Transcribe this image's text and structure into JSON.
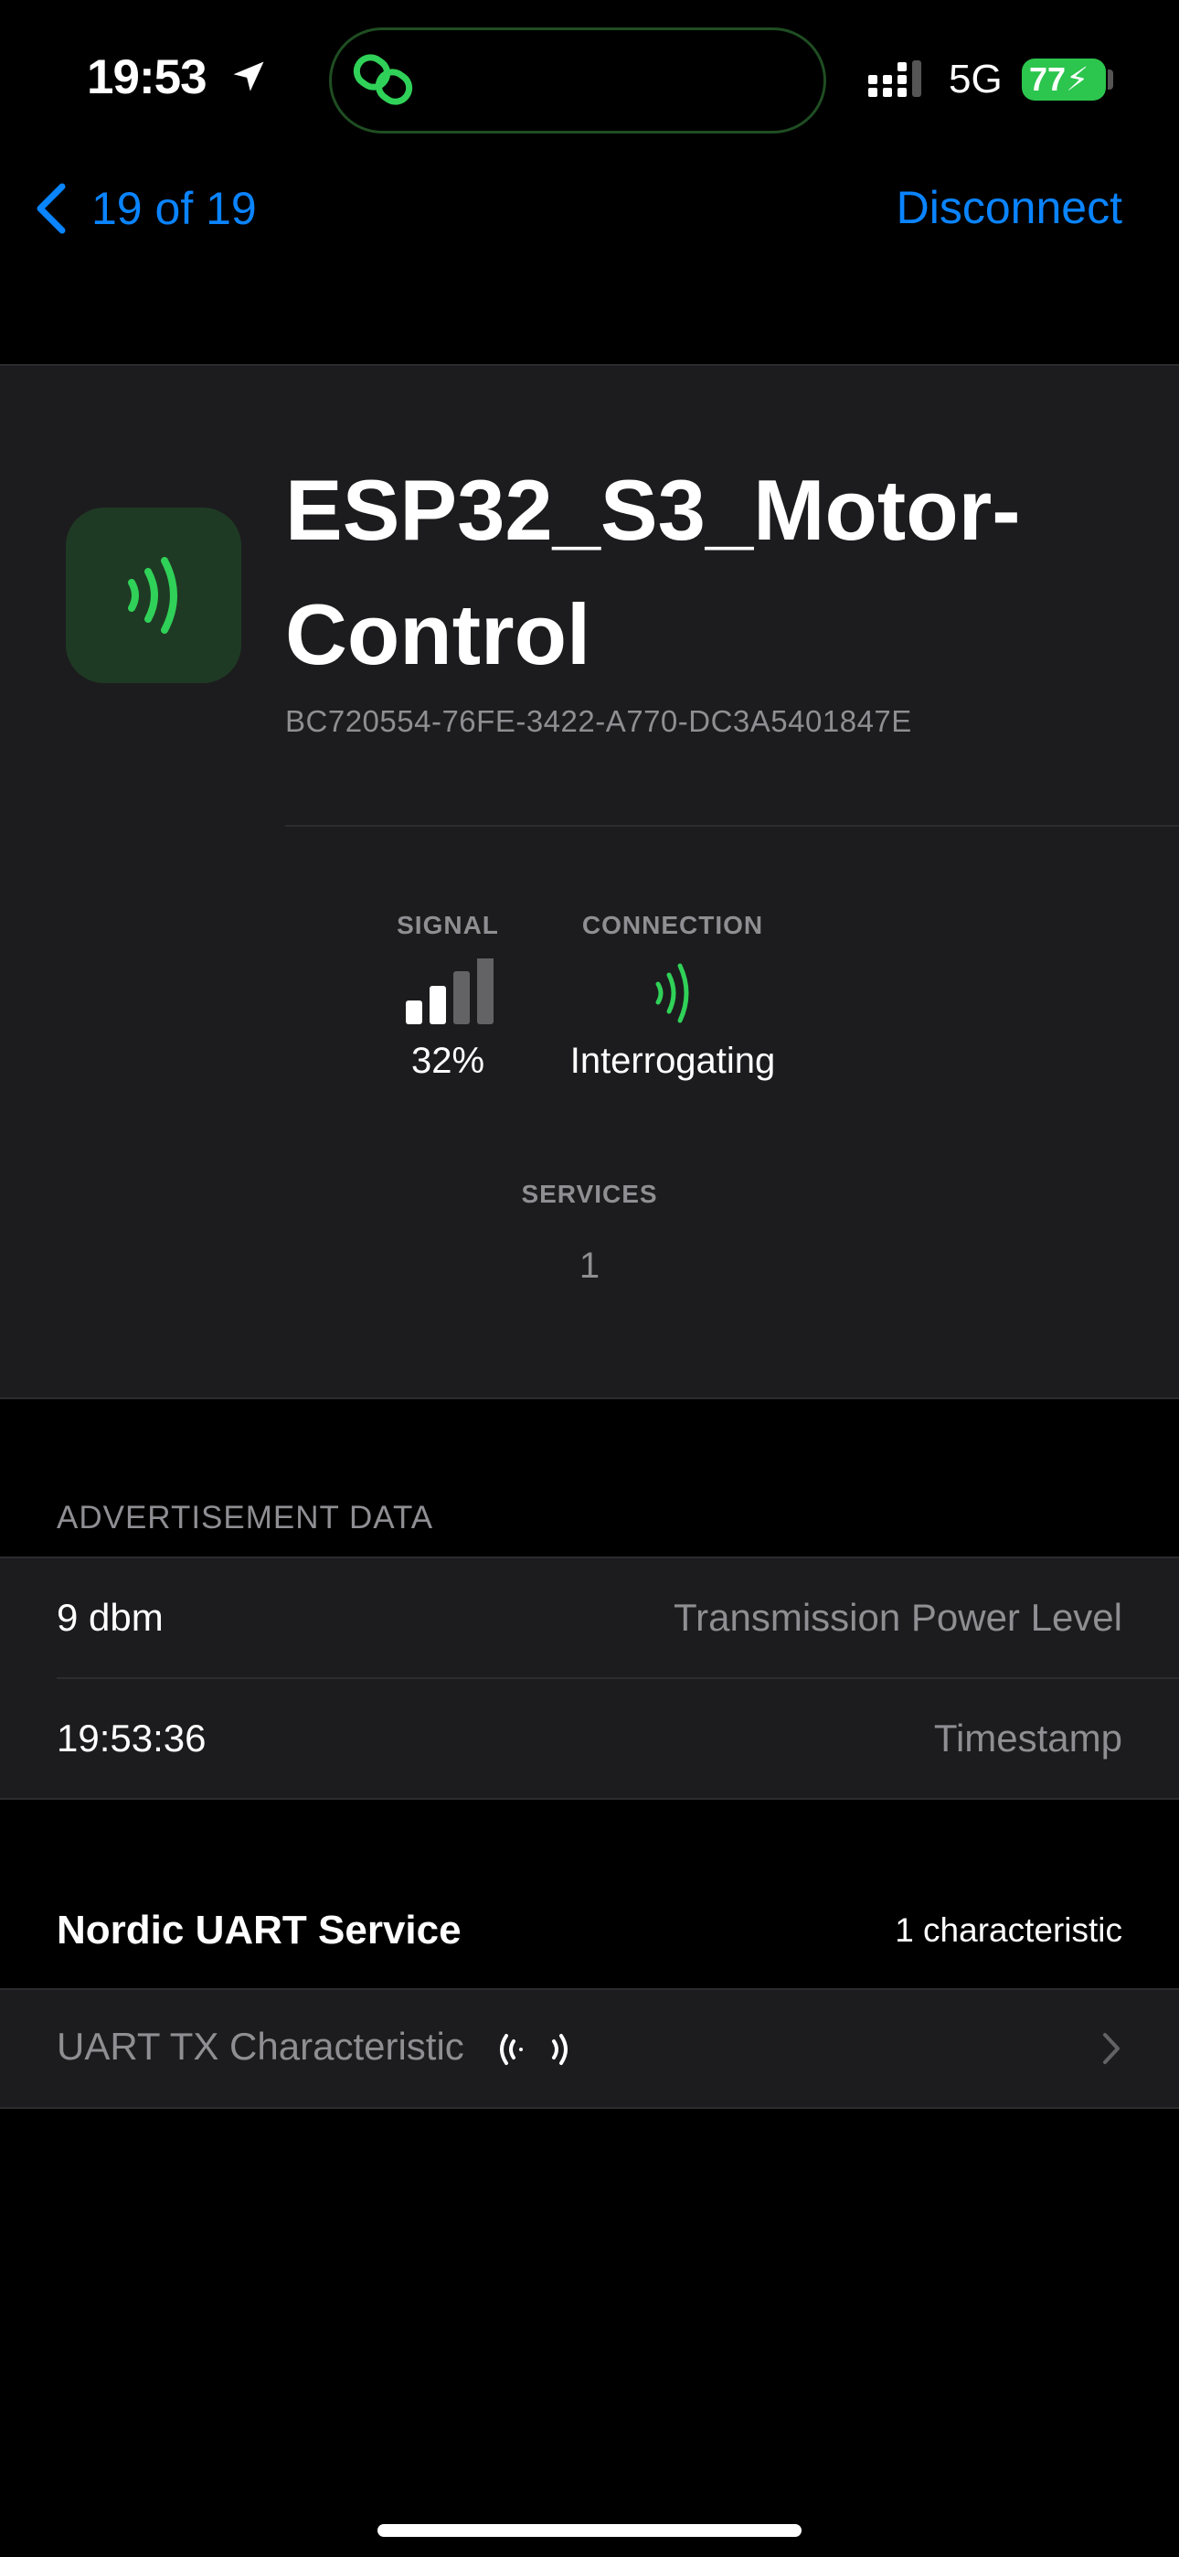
{
  "status_bar": {
    "time": "19:53",
    "network": "5G",
    "battery": "77"
  },
  "nav": {
    "back_label": "19 of 19",
    "action_label": "Disconnect"
  },
  "device": {
    "name": "ESP32_S3_Motor-Control",
    "uuid": "BC720554-76FE-3422-A770-DC3A5401847E",
    "signal_label": "SIGNAL",
    "signal_value": "32%",
    "signal_level": 0.32,
    "connection_label": "CONNECTION",
    "connection_value": "Interrogating",
    "services_label": "SERVICES",
    "services_value": "1"
  },
  "advertisement": {
    "header": "ADVERTISEMENT DATA",
    "rows": [
      {
        "value": "9 dbm",
        "label": "Transmission Power Level"
      },
      {
        "value": "19:53:36",
        "label": "Timestamp"
      }
    ]
  },
  "service": {
    "title": "Nordic UART Service",
    "count": "1 characteristic",
    "characteristics": [
      {
        "name": "UART TX Characteristic"
      }
    ]
  },
  "colors": {
    "accent": "#0a84ff",
    "connected_green": "#30d158",
    "card_bg": "#1c1c1e",
    "secondary_text": "#8e8e93"
  },
  "icons": {
    "location": "location-arrow-icon",
    "link": "link-icon",
    "cellular": "cellular-signal-icon",
    "battery": "battery-charging-icon",
    "back": "chevron-left-icon",
    "device": "wireless-icon",
    "signal": "signal-bars-icon",
    "connection": "wireless-icon",
    "notify": "broadcast-icon",
    "disclosure": "chevron-right-icon"
  }
}
